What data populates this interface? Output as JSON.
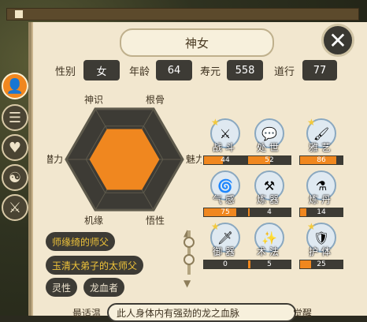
{
  "title": "神女",
  "close_label": "✕",
  "stats": [
    {
      "label": "性别",
      "value": "女"
    },
    {
      "label": "年龄",
      "value": "64"
    },
    {
      "label": "寿元",
      "value": "558"
    },
    {
      "label": "道行",
      "value": "77"
    }
  ],
  "radar": {
    "labels": [
      "神识",
      "根骨",
      "魅力",
      "悟性",
      "机缘",
      "潜力"
    ],
    "values": [
      0.6,
      0.6,
      0.6,
      0.6,
      0.6,
      0.6
    ],
    "fill_color": "#f0871f"
  },
  "relations": [
    {
      "text": "师缘绮的师父",
      "style": "gold"
    },
    {
      "text": "玉清大弟子的太师父",
      "style": "gold"
    },
    {
      "text": "灵性",
      "style": "gray"
    },
    {
      "text": "龙血者",
      "style": "gray"
    }
  ],
  "skills": [
    {
      "label": "战斗",
      "value": "44",
      "icon": "sword-icon",
      "glyph": "⚔",
      "star": true
    },
    {
      "label": "处世",
      "value": "52",
      "icon": "chat-icon",
      "glyph": "💬",
      "star": false
    },
    {
      "label": "雅艺",
      "value": "86",
      "icon": "brush-icon",
      "glyph": "🖌",
      "star": true
    },
    {
      "label": "气感",
      "value": "75",
      "icon": "wind-icon",
      "glyph": "🌀",
      "star": false
    },
    {
      "label": "炼器",
      "value": "4",
      "icon": "cauldron-icon",
      "glyph": "⚒",
      "star": false
    },
    {
      "label": "炼丹",
      "value": "14",
      "icon": "elixir-icon",
      "glyph": "⚗",
      "star": false
    },
    {
      "label": "御器",
      "value": "0",
      "icon": "flying-sword-icon",
      "glyph": "🗡",
      "star": true
    },
    {
      "label": "术法",
      "value": "5",
      "icon": "spell-icon",
      "glyph": "✨",
      "star": false
    },
    {
      "label": "护体",
      "value": "25",
      "icon": "shield-icon",
      "glyph": "🛡",
      "star": true
    }
  ],
  "bottom": {
    "label": "最适温",
    "tooltip": "此人身体内有强劲的龙之血脉",
    "right": "觉醒"
  },
  "tabs": [
    {
      "icon": "person-icon",
      "glyph": "👤",
      "active": true
    },
    {
      "icon": "scroll-icon",
      "glyph": "☰",
      "active": false
    },
    {
      "icon": "heart-icon",
      "glyph": "♥",
      "active": false
    },
    {
      "icon": "yinyang-icon",
      "glyph": "☯",
      "active": false
    },
    {
      "icon": "sword-tab-icon",
      "glyph": "⚔",
      "active": false
    }
  ]
}
